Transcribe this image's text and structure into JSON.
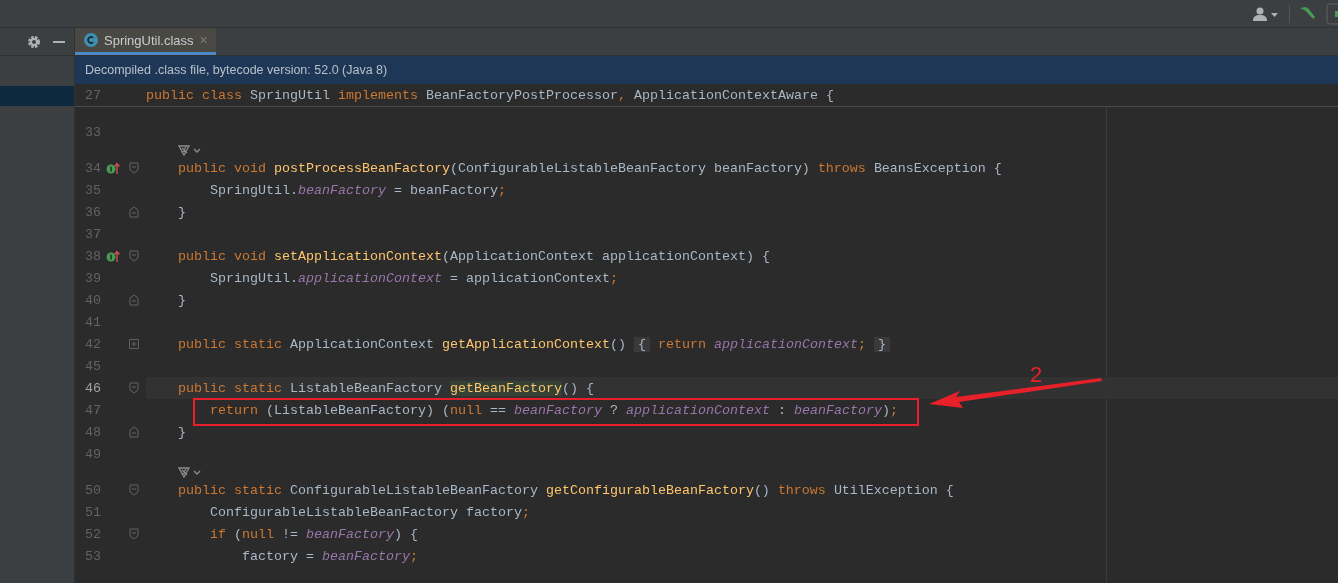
{
  "side_panel": {
    "rows": [
      {
        "selected": true
      }
    ]
  },
  "tabs": [
    {
      "label": "SpringUtil.class",
      "close": "×",
      "selected": true
    }
  ],
  "banner": {
    "text": "Decompiled .class file, bytecode version: 52.0 (Java 8)"
  },
  "editor": {
    "sticky_line": {
      "number": "27",
      "tokens": [
        {
          "kind": "keyword",
          "text": "public class "
        },
        {
          "kind": "plain",
          "text": "SpringUtil "
        },
        {
          "kind": "keyword",
          "text": "implements "
        },
        {
          "kind": "plain",
          "text": "BeanFactoryPostProcessor"
        },
        {
          "kind": "separator",
          "text": ", "
        },
        {
          "kind": "plain",
          "text": "ApplicationContextAware {"
        }
      ]
    },
    "lines": [
      {
        "kind": "code",
        "number": "33",
        "current": false
      },
      {
        "kind": "hint"
      },
      {
        "kind": "code",
        "number": "34",
        "marker": {
          "kind": "override"
        },
        "fold": {
          "kind": "start"
        },
        "current": false,
        "tokens": [
          {
            "kind": "keyword",
            "text": "    public void "
          },
          {
            "kind": "method",
            "text": "postProcessBeanFactory"
          },
          {
            "kind": "plain",
            "text": "(ConfigurableListableBeanFactory beanFactory) "
          },
          {
            "kind": "keyword",
            "text": "throws "
          },
          {
            "kind": "plain",
            "text": "BeansException {"
          }
        ]
      },
      {
        "kind": "code",
        "number": "35",
        "current": false,
        "tokens": [
          {
            "kind": "plain",
            "text": "        SpringUtil."
          },
          {
            "kind": "field",
            "text": "beanFactory"
          },
          {
            "kind": "plain",
            "text": " = beanFactory"
          },
          {
            "kind": "separator",
            "text": ";"
          }
        ]
      },
      {
        "kind": "code",
        "number": "36",
        "fold": {
          "kind": "end"
        },
        "current": false,
        "tokens": [
          {
            "kind": "plain",
            "text": "    }"
          }
        ]
      },
      {
        "kind": "code",
        "number": "37",
        "current": false
      },
      {
        "kind": "code",
        "number": "38",
        "marker": {
          "kind": "override"
        },
        "fold": {
          "kind": "start"
        },
        "current": false,
        "tokens": [
          {
            "kind": "keyword",
            "text": "    public void "
          },
          {
            "kind": "method",
            "text": "setApplicationContext"
          },
          {
            "kind": "plain",
            "text": "(ApplicationContext applicationContext) {"
          }
        ]
      },
      {
        "kind": "code",
        "number": "39",
        "current": false,
        "tokens": [
          {
            "kind": "plain",
            "text": "        SpringUtil."
          },
          {
            "kind": "field",
            "text": "applicationContext"
          },
          {
            "kind": "plain",
            "text": " = applicationContext"
          },
          {
            "kind": "separator",
            "text": ";"
          }
        ]
      },
      {
        "kind": "code",
        "number": "40",
        "fold": {
          "kind": "end"
        },
        "current": false,
        "tokens": [
          {
            "kind": "plain",
            "text": "    }"
          }
        ]
      },
      {
        "kind": "code",
        "number": "41",
        "current": false
      },
      {
        "kind": "code",
        "number": "42",
        "fold": {
          "kind": "collapsed"
        },
        "current": false,
        "tokens": [
          {
            "kind": "keyword",
            "text": "    public static "
          },
          {
            "kind": "plain",
            "text": "ApplicationContext "
          },
          {
            "kind": "method",
            "text": "getApplicationContext"
          },
          {
            "kind": "plain",
            "text": "() "
          },
          {
            "kind": "folded",
            "text": "{"
          },
          {
            "kind": "keyword",
            "text": " return "
          },
          {
            "kind": "field",
            "text": "applicationContext"
          },
          {
            "kind": "separator",
            "text": "; "
          },
          {
            "kind": "folded",
            "text": "}"
          }
        ]
      },
      {
        "kind": "code",
        "number": "45",
        "current": false
      },
      {
        "kind": "code",
        "number": "46",
        "fold": {
          "kind": "start"
        },
        "current": true,
        "tokens": [
          {
            "kind": "keyword",
            "text": "    public static "
          },
          {
            "kind": "plain",
            "text": "ListableBeanFactory "
          },
          {
            "kind": "method-usage",
            "text": "getBeanFactory"
          },
          {
            "kind": "plain",
            "text": "() {"
          }
        ]
      },
      {
        "kind": "code",
        "number": "47",
        "boxed": true,
        "current": false,
        "tokens": [
          {
            "kind": "keyword",
            "text": "        return "
          },
          {
            "kind": "plain",
            "text": "(ListableBeanFactory) ("
          },
          {
            "kind": "keyword",
            "text": "null "
          },
          {
            "kind": "plain",
            "text": "== "
          },
          {
            "kind": "field",
            "text": "beanFactory"
          },
          {
            "kind": "plain",
            "text": " ? "
          },
          {
            "kind": "field",
            "text": "applicationContext"
          },
          {
            "kind": "plain",
            "text": " : "
          },
          {
            "kind": "field",
            "text": "beanFactory"
          },
          {
            "kind": "plain",
            "text": ")"
          },
          {
            "kind": "separator",
            "text": ";"
          }
        ]
      },
      {
        "kind": "code",
        "number": "48",
        "fold": {
          "kind": "end"
        },
        "current": false,
        "tokens": [
          {
            "kind": "plain",
            "text": "    }"
          }
        ]
      },
      {
        "kind": "code",
        "number": "49",
        "current": false
      },
      {
        "kind": "hint"
      },
      {
        "kind": "code",
        "number": "50",
        "fold": {
          "kind": "start"
        },
        "current": false,
        "tokens": [
          {
            "kind": "keyword",
            "text": "    public static "
          },
          {
            "kind": "plain",
            "text": "ConfigurableListableBeanFactory "
          },
          {
            "kind": "method",
            "text": "getConfigurableBeanFactory"
          },
          {
            "kind": "plain",
            "text": "() "
          },
          {
            "kind": "keyword",
            "text": "throws "
          },
          {
            "kind": "plain",
            "text": "UtilException {"
          }
        ]
      },
      {
        "kind": "code",
        "number": "51",
        "current": false,
        "tokens": [
          {
            "kind": "plain",
            "text": "        ConfigurableListableBeanFactory factory"
          },
          {
            "kind": "separator",
            "text": ";"
          }
        ]
      },
      {
        "kind": "code",
        "number": "52",
        "fold": {
          "kind": "start"
        },
        "current": false,
        "tokens": [
          {
            "kind": "keyword",
            "text": "        if "
          },
          {
            "kind": "plain",
            "text": "("
          },
          {
            "kind": "keyword",
            "text": "null "
          },
          {
            "kind": "plain",
            "text": "!= "
          },
          {
            "kind": "field",
            "text": "beanFactory"
          },
          {
            "kind": "plain",
            "text": ") {"
          }
        ]
      },
      {
        "kind": "code",
        "number": "53",
        "current": false,
        "tokens": [
          {
            "kind": "plain",
            "text": "            factory = "
          },
          {
            "kind": "field",
            "text": "beanFactory"
          },
          {
            "kind": "separator",
            "text": ";"
          }
        ]
      }
    ],
    "annotation": {
      "label": "2"
    }
  }
}
